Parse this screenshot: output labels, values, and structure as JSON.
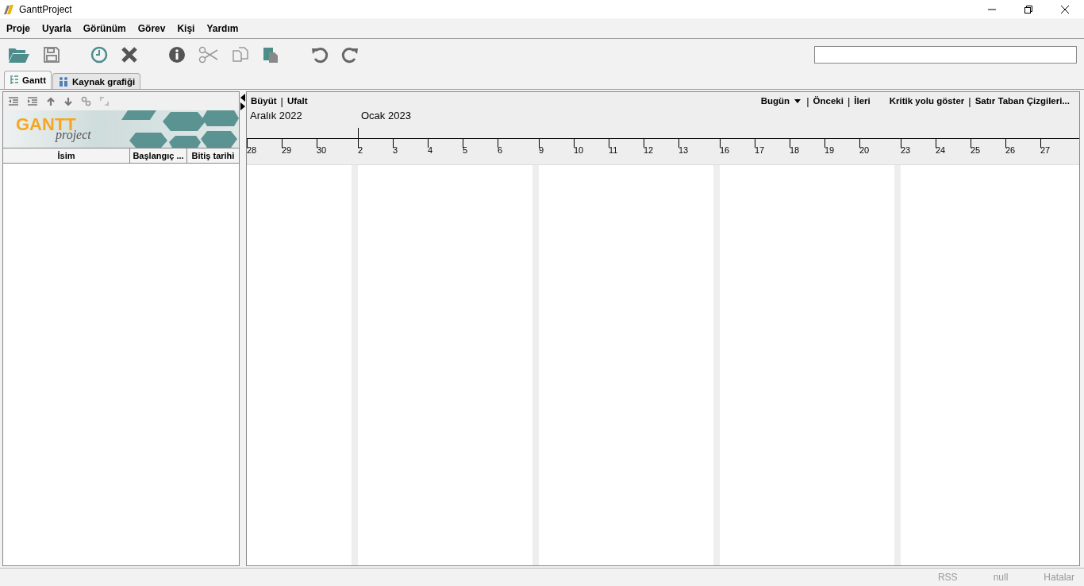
{
  "window": {
    "title": "GanttProject"
  },
  "menu": [
    "Proje",
    "Uyarla",
    "Görünüm",
    "Görev",
    "Kişi",
    "Yardım"
  ],
  "tabs": [
    {
      "label": "Gantt",
      "kind": "gantt",
      "selected": true
    },
    {
      "label": "Kaynak grafiği",
      "kind": "resources",
      "selected": false
    }
  ],
  "logo": {
    "title": "GANTT",
    "subtitle": "project"
  },
  "table": {
    "columns": [
      "İsim",
      "Başlangıç ...",
      "Bitiş tarihi"
    ]
  },
  "chart_nav_left": [
    {
      "kind": "link",
      "text": "Büyüt"
    },
    {
      "kind": "separator",
      "text": "|"
    },
    {
      "kind": "link",
      "text": "Ufalt"
    }
  ],
  "chart_nav_right": [
    {
      "kind": "dropdown",
      "text": "Bugün"
    },
    {
      "kind": "separator",
      "text": "|"
    },
    {
      "kind": "link",
      "text": "Önceki"
    },
    {
      "kind": "separator",
      "text": "|"
    },
    {
      "kind": "link",
      "text": "İleri"
    },
    {
      "kind": "gap"
    },
    {
      "kind": "link",
      "text": "Kritik yolu göster"
    },
    {
      "kind": "separator",
      "text": "|"
    },
    {
      "kind": "link",
      "text": "Satır Taban Çizgileri..."
    }
  ],
  "months": [
    {
      "label": "Aralık 2022",
      "days": [
        {
          "kind": "day",
          "label": "28"
        },
        {
          "kind": "day",
          "label": "29"
        },
        {
          "kind": "day",
          "label": "30"
        },
        {
          "kind": "weekend"
        }
      ]
    },
    {
      "label": "Ocak 2023",
      "days": [
        {
          "kind": "day",
          "label": "2"
        },
        {
          "kind": "day",
          "label": "3"
        },
        {
          "kind": "day",
          "label": "4"
        },
        {
          "kind": "day",
          "label": "5"
        },
        {
          "kind": "day",
          "label": "6"
        },
        {
          "kind": "weekend"
        },
        {
          "kind": "day",
          "label": "9"
        },
        {
          "kind": "day",
          "label": "10"
        },
        {
          "kind": "day",
          "label": "11"
        },
        {
          "kind": "day",
          "label": "12"
        },
        {
          "kind": "day",
          "label": "13"
        },
        {
          "kind": "weekend"
        },
        {
          "kind": "day",
          "label": "16"
        },
        {
          "kind": "day",
          "label": "17"
        },
        {
          "kind": "day",
          "label": "18"
        },
        {
          "kind": "day",
          "label": "19"
        },
        {
          "kind": "day",
          "label": "20"
        },
        {
          "kind": "weekend"
        },
        {
          "kind": "day",
          "label": "23"
        },
        {
          "kind": "day",
          "label": "24"
        },
        {
          "kind": "day",
          "label": "25"
        },
        {
          "kind": "day",
          "label": "26"
        },
        {
          "kind": "day",
          "label": "27"
        }
      ]
    }
  ],
  "status_bar": [
    "RSS",
    "null",
    "Hatalar"
  ]
}
